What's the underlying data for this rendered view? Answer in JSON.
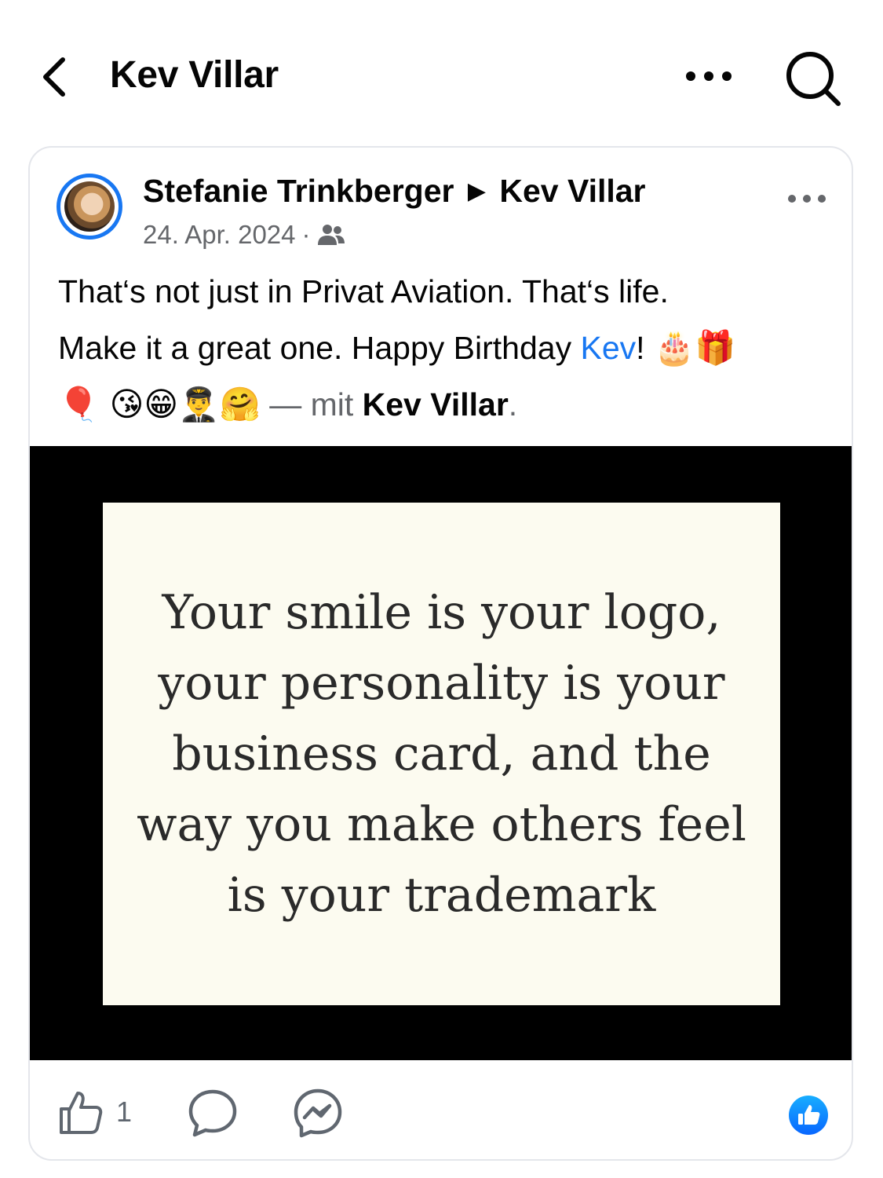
{
  "header": {
    "title": "Kev Villar",
    "back_icon": "chevron-left-icon",
    "more_icon": "ellipsis-icon",
    "search_icon": "search-icon"
  },
  "post": {
    "author": "Stefanie Trinkberger",
    "separator": "▶",
    "target": "Kev Villar",
    "date": "24. Apr. 2024",
    "meta_separator": "·",
    "audience_icon": "friends-icon",
    "text_line1": "That‘s not just in Privat Aviation. That‘s life.",
    "text_line2_prefix": "Make it a great one. Happy Birthday ",
    "mention": "Kev",
    "text_line2_suffix": "!",
    "emojis_line2": "🎂🎁",
    "emojis_line3": "🎈 😘😁👨‍✈️🤗",
    "with_prefix": " — mit ",
    "with_name": "Kev Villar",
    "with_suffix": ".",
    "image_quote": "Your smile is your logo, your personality is your business card, and the way you make others feel is your trademark"
  },
  "actions": {
    "like_count": "1",
    "like_icon": "thumbs-up-icon",
    "comment_icon": "comment-icon",
    "share_icon": "messenger-icon",
    "reaction_icon": "like-reaction-icon"
  },
  "colors": {
    "accent": "#1877f2",
    "muted": "#65676b",
    "card_border": "#e4e6eb",
    "quote_bg": "#fcfbf0"
  }
}
